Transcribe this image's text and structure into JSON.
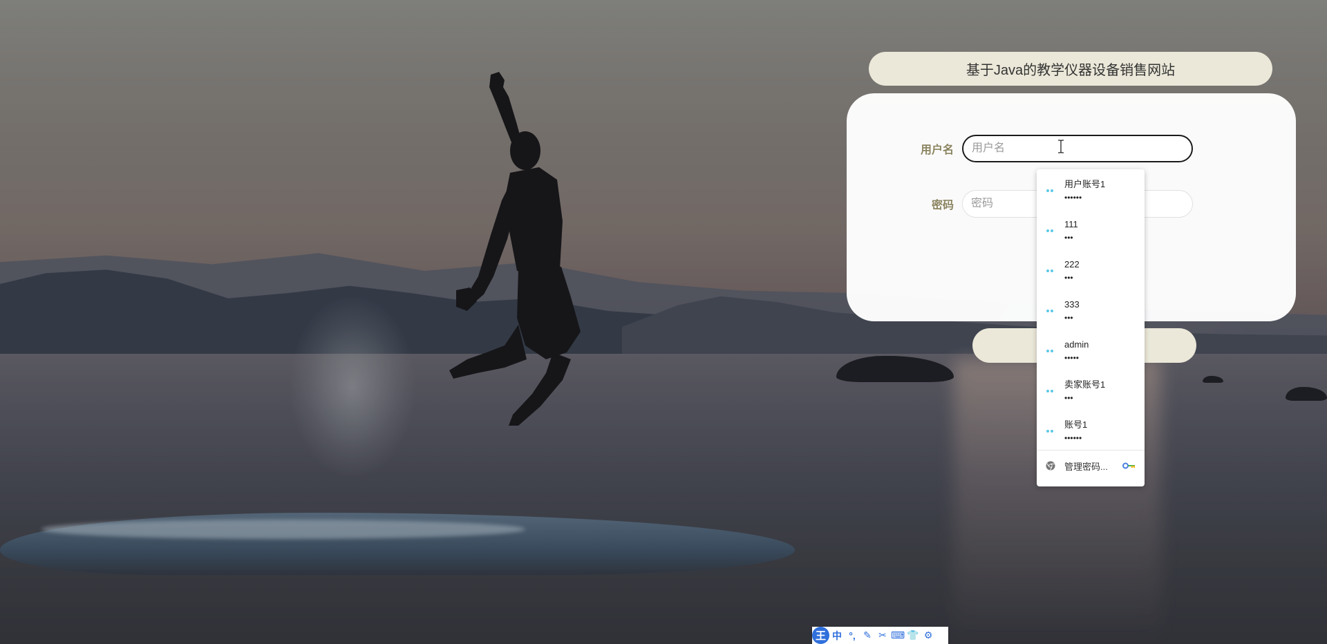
{
  "site": {
    "title": "基于Java的教学仪器设备销售网站"
  },
  "form": {
    "username": {
      "label": "用户名",
      "placeholder": "用户名",
      "value": ""
    },
    "password": {
      "label": "密码",
      "placeholder": "密码",
      "value": ""
    },
    "login_button_label": ""
  },
  "autofill": {
    "items": [
      {
        "username": "用户账号1",
        "mask": "••••••"
      },
      {
        "username": "111",
        "mask": "•••"
      },
      {
        "username": "222",
        "mask": "•••"
      },
      {
        "username": "333",
        "mask": "•••"
      },
      {
        "username": "admin",
        "mask": "•••••"
      },
      {
        "username": "卖家账号1",
        "mask": "•••"
      },
      {
        "username": "账号1",
        "mask": "••••••"
      }
    ],
    "manage_label": "管理密码...",
    "icon": "key-icon"
  },
  "ime_toolbar": {
    "logo": "王",
    "buttons": [
      "中",
      "°,",
      "✎",
      "✂",
      "⌨",
      "👕",
      "⚙"
    ]
  },
  "colors": {
    "title_bg": "#ebe8d9",
    "label_color": "#8a8460",
    "key_icon_color": "#5bc8e8",
    "ime_blue": "#2f6fdc"
  }
}
